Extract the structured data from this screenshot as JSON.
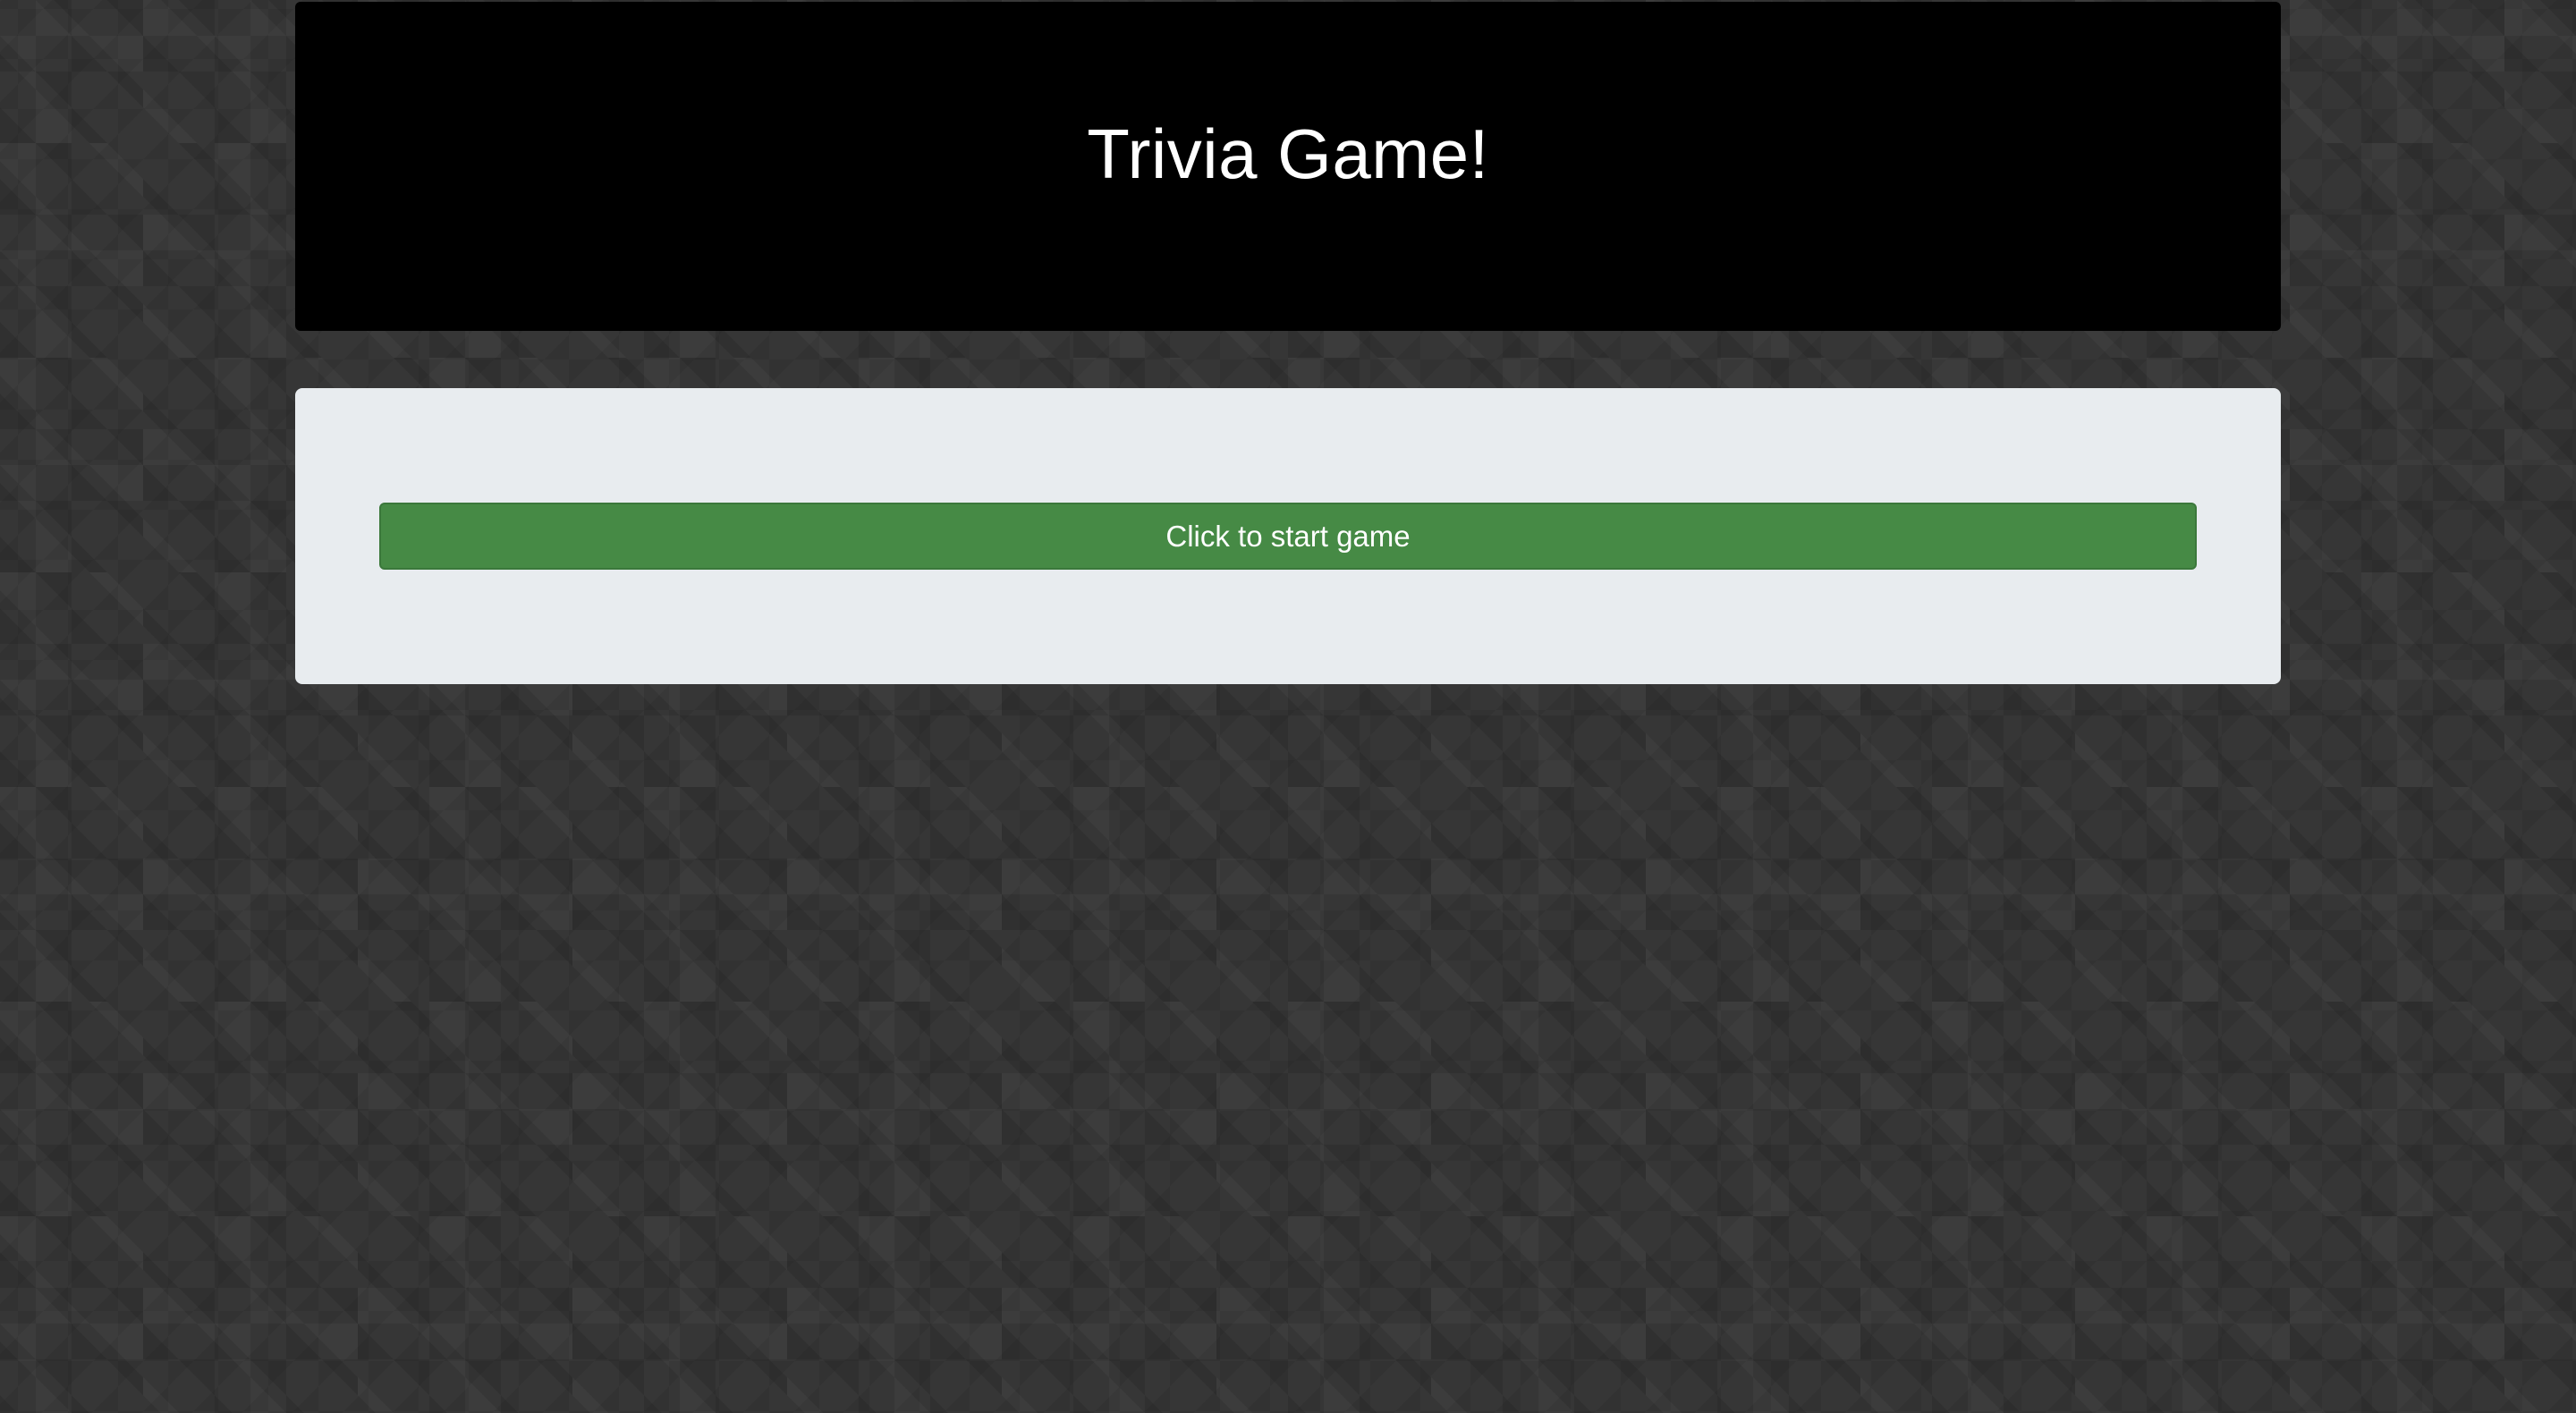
{
  "header": {
    "title": "Trivia Game!"
  },
  "game": {
    "start_button_label": "Click to start game"
  },
  "colors": {
    "background": "#363636",
    "header_bg": "#000000",
    "panel_bg": "#e8ecef",
    "button_bg": "#468a45",
    "button_text": "#ffffff"
  }
}
